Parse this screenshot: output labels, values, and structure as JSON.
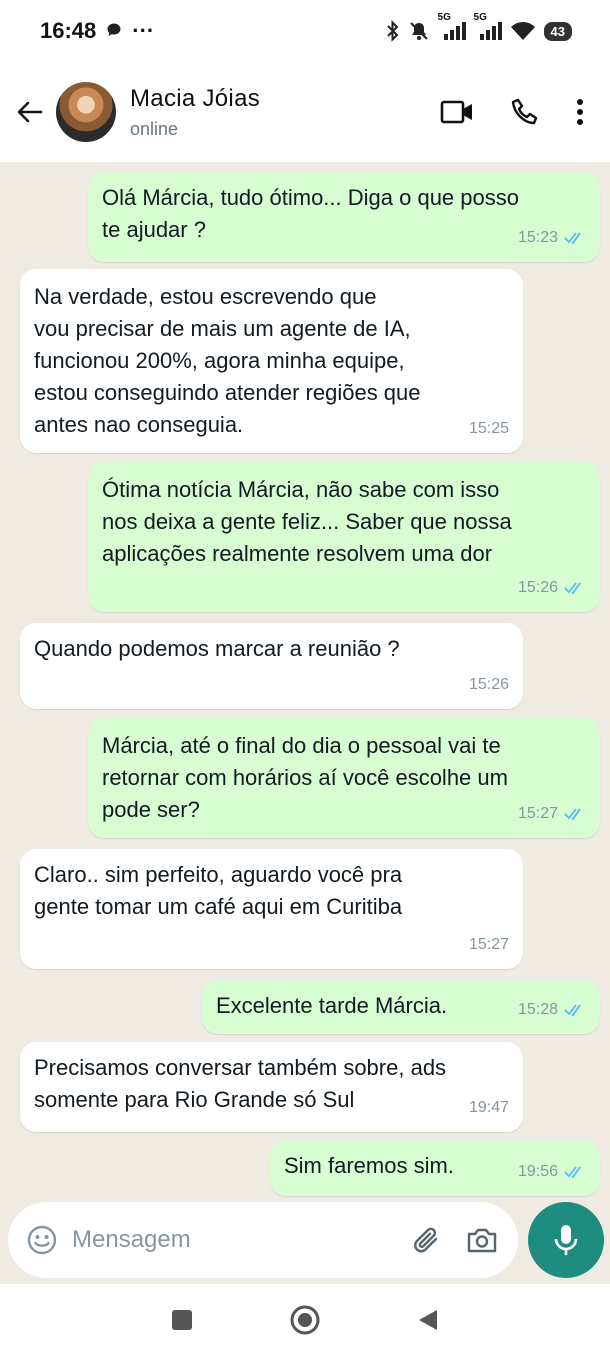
{
  "status_bar": {
    "time": "16:48",
    "dots": "···",
    "network_1": "5G",
    "network_2": "5G",
    "battery": "43"
  },
  "header": {
    "contact_name": "Macia Jóias",
    "contact_status": "online"
  },
  "messages": [
    {
      "dir": "out",
      "text": "Olá Márcia, tudo ótimo... Diga o que posso\nte ajudar ?",
      "time": "15:23",
      "read": true
    },
    {
      "dir": "in",
      "text": "Na verdade, estou escrevendo que\nvou precisar de mais um agente de IA,\nfuncionou 200%, agora minha equipe,\nestou conseguindo atender regiões que\nantes nao conseguia.",
      "time": "15:25"
    },
    {
      "dir": "out",
      "text": "Ótima notícia Márcia, não sabe com isso\nnos deixa a gente feliz... Saber que nossa\naplicações realmente resolvem uma dor",
      "time": "15:26",
      "read": true
    },
    {
      "dir": "in",
      "text": "Quando podemos marcar a reunião ?",
      "time": "15:26"
    },
    {
      "dir": "out",
      "text": "Márcia, até o final do dia o pessoal vai te\nretornar com  horários aí você escolhe um\npode ser?",
      "time": "15:27",
      "read": true
    },
    {
      "dir": "in",
      "text": "Claro.. sim perfeito, aguardo você pra\ngente tomar um café aqui em Curitiba",
      "time": "15:27"
    },
    {
      "dir": "out",
      "text": "Excelente tarde Márcia.",
      "time": "15:28",
      "read": true
    },
    {
      "dir": "in",
      "text": "Precisamos conversar também sobre, ads\nsomente para Rio Grande só Sul",
      "time": "19:47"
    },
    {
      "dir": "out",
      "text": "Sim faremos sim.",
      "time": "19:56",
      "read": true
    }
  ],
  "input": {
    "placeholder": "Mensagem"
  },
  "colors": {
    "outgoing_bubble": "#d9fdd3",
    "incoming_bubble": "#ffffff",
    "chat_background": "#efeae2",
    "read_ticks": "#53bdeb",
    "mic_button": "#1e8c7e"
  }
}
